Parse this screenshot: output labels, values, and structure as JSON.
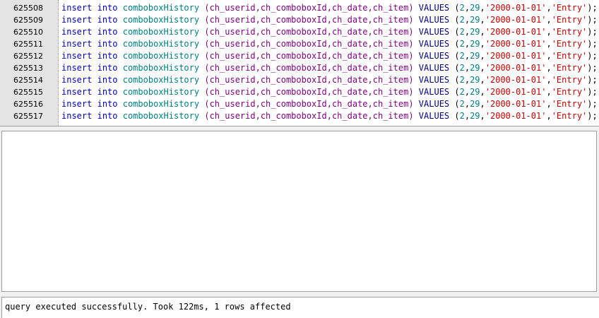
{
  "editor": {
    "lines": [
      {
        "num": "625508",
        "kw1": "insert",
        "kw2": "into",
        "table": "comboboxHistory",
        "cols": "(ch_userid,ch_comboboxId,ch_date,ch_item)",
        "values_kw": "VALUES",
        "n1": "2",
        "n2": "29",
        "s1": "'2000-01-01'",
        "s2": "'Entry'"
      },
      {
        "num": "625509",
        "kw1": "insert",
        "kw2": "into",
        "table": "comboboxHistory",
        "cols": "(ch_userid,ch_comboboxId,ch_date,ch_item)",
        "values_kw": "VALUES",
        "n1": "2",
        "n2": "29",
        "s1": "'2000-01-01'",
        "s2": "'Entry'"
      },
      {
        "num": "625510",
        "kw1": "insert",
        "kw2": "into",
        "table": "comboboxHistory",
        "cols": "(ch_userid,ch_comboboxId,ch_date,ch_item)",
        "values_kw": "VALUES",
        "n1": "2",
        "n2": "29",
        "s1": "'2000-01-01'",
        "s2": "'Entry'"
      },
      {
        "num": "625511",
        "kw1": "insert",
        "kw2": "into",
        "table": "comboboxHistory",
        "cols": "(ch_userid,ch_comboboxId,ch_date,ch_item)",
        "values_kw": "VALUES",
        "n1": "2",
        "n2": "29",
        "s1": "'2000-01-01'",
        "s2": "'Entry'"
      },
      {
        "num": "625512",
        "kw1": "insert",
        "kw2": "into",
        "table": "comboboxHistory",
        "cols": "(ch_userid,ch_comboboxId,ch_date,ch_item)",
        "values_kw": "VALUES",
        "n1": "2",
        "n2": "29",
        "s1": "'2000-01-01'",
        "s2": "'Entry'"
      },
      {
        "num": "625513",
        "kw1": "insert",
        "kw2": "into",
        "table": "comboboxHistory",
        "cols": "(ch_userid,ch_comboboxId,ch_date,ch_item)",
        "values_kw": "VALUES",
        "n1": "2",
        "n2": "29",
        "s1": "'2000-01-01'",
        "s2": "'Entry'"
      },
      {
        "num": "625514",
        "kw1": "insert",
        "kw2": "into",
        "table": "comboboxHistory",
        "cols": "(ch_userid,ch_comboboxId,ch_date,ch_item)",
        "values_kw": "VALUES",
        "n1": "2",
        "n2": "29",
        "s1": "'2000-01-01'",
        "s2": "'Entry'"
      },
      {
        "num": "625515",
        "kw1": "insert",
        "kw2": "into",
        "table": "comboboxHistory",
        "cols": "(ch_userid,ch_comboboxId,ch_date,ch_item)",
        "values_kw": "VALUES",
        "n1": "2",
        "n2": "29",
        "s1": "'2000-01-01'",
        "s2": "'Entry'"
      },
      {
        "num": "625516",
        "kw1": "insert",
        "kw2": "into",
        "table": "comboboxHistory",
        "cols": "(ch_userid,ch_comboboxId,ch_date,ch_item)",
        "values_kw": "VALUES",
        "n1": "2",
        "n2": "29",
        "s1": "'2000-01-01'",
        "s2": "'Entry'"
      },
      {
        "num": "625517",
        "kw1": "insert",
        "kw2": "into",
        "table": "comboboxHistory",
        "cols": "(ch_userid,ch_comboboxId,ch_date,ch_item)",
        "values_kw": "VALUES",
        "n1": "2",
        "n2": "29",
        "s1": "'2000-01-01'",
        "s2": "'Entry'"
      }
    ]
  },
  "status": {
    "message": "query executed successfully. Took 122ms, 1 rows affected"
  }
}
